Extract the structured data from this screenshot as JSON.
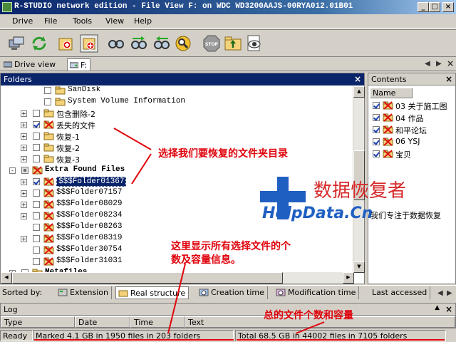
{
  "window": {
    "title": "R-STUDIO network edition - File View F: on WDC WD3200AAJS-00RYA012.01B01"
  },
  "menu": [
    {
      "label": "Drive"
    },
    {
      "label": "File"
    },
    {
      "label": "Tools"
    },
    {
      "label": "View"
    },
    {
      "label": "Help"
    }
  ],
  "tabs": {
    "drive_view": "Drive view",
    "active": "F:"
  },
  "folders": {
    "header": "Folders",
    "rows": [
      {
        "label": "SanDisk",
        "checked": false
      },
      {
        "label": "System Volume Information",
        "checked": false
      },
      {
        "label": "包含删除-2",
        "checked": false
      },
      {
        "label": "丢失的文件",
        "checked": true
      },
      {
        "label": "恢复-1",
        "checked": false
      },
      {
        "label": "恢复-2",
        "checked": false
      },
      {
        "label": "恢复-3",
        "checked": false
      },
      {
        "label": "Extra Found Files",
        "checked": "partial"
      },
      {
        "label": "$$$Folder01367",
        "checked": true,
        "selected": true
      },
      {
        "label": "$$$Folder07157",
        "checked": false
      },
      {
        "label": "$$$Folder08029",
        "checked": false
      },
      {
        "label": "$$$Folder08234",
        "checked": false
      },
      {
        "label": "$$$Folder08263",
        "checked": false
      },
      {
        "label": "$$$Folder08319",
        "checked": false
      },
      {
        "label": "$$$Folder30754",
        "checked": false
      },
      {
        "label": "$$$Folder31031",
        "checked": false
      },
      {
        "label": "Metafiles",
        "checked": false
      }
    ]
  },
  "contents": {
    "header": "Contents",
    "column": "Name",
    "items": [
      {
        "label": "03 关于施工图"
      },
      {
        "label": "04 作品"
      },
      {
        "label": "和平论坛"
      },
      {
        "label": "06 YSJ"
      },
      {
        "label": "宝贝"
      }
    ]
  },
  "sortbar": {
    "label": "Sorted by:",
    "tabs": [
      {
        "label": "Extension"
      },
      {
        "label": "Real structure"
      },
      {
        "label": "Creation time"
      },
      {
        "label": "Modification time"
      },
      {
        "label": "Last accessed"
      }
    ]
  },
  "log": {
    "header": "Log",
    "columns": [
      "Type",
      "Date",
      "Time",
      "Text"
    ]
  },
  "status": {
    "state": "Ready",
    "marked": "Marked 4.1 GB in 1950 files in 203 folders",
    "total": "Total 68.5 GB in 44002 files in 7105 folders"
  },
  "annotations": {
    "select_folder": "选择我们要恢复的文件夹目录",
    "shows_selected_line1": "这里显示所有选择文件的个",
    "shows_selected_line2": "数及容量信息。",
    "total_info": "总的文件个数和容量"
  },
  "watermark": {
    "cn": "数据恢复者",
    "logo": "HelpData.Cn",
    "sub": "我们专注于数据恢复"
  },
  "colors": {
    "title_bar": "#0a246a",
    "annotation": "#e0000a",
    "watermark_blue": "#1f5fc2"
  }
}
